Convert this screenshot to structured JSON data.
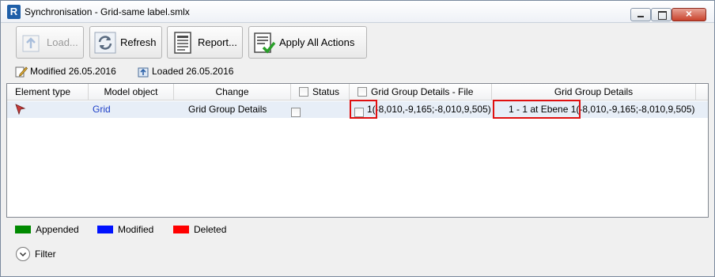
{
  "window": {
    "title": "Synchronisation - Grid-same label.smlx",
    "app_icon_letter": "R",
    "close_glyph": "×"
  },
  "toolbar": {
    "load_label": "Load...",
    "refresh_label": "Refresh",
    "report_label": "Report...",
    "apply_label": "Apply All Actions"
  },
  "status": {
    "modified": "Modified 26.05.2016",
    "loaded": "Loaded 26.05.2016"
  },
  "grid": {
    "headers": {
      "element_type": "Element type",
      "model_object": "Model object",
      "change": "Change",
      "status": "Status",
      "file": "Grid Group Details - File",
      "details": "Grid Group Details"
    },
    "rows": [
      {
        "model_object": "Grid",
        "change": "Grid Group Details",
        "file_value": "1(-8,010,-9,165;-8,010,9,505)",
        "details_value": "1 - 1 at Ebene 1(-8,010,-9,165;-8,010,9,505)"
      }
    ]
  },
  "legend": {
    "appended": "Appended",
    "modified": "Modified",
    "deleted": "Deleted",
    "colors": {
      "appended": "#008a00",
      "modified": "#0012ff",
      "deleted": "#ff0000"
    }
  },
  "filter": {
    "label": "Filter"
  }
}
